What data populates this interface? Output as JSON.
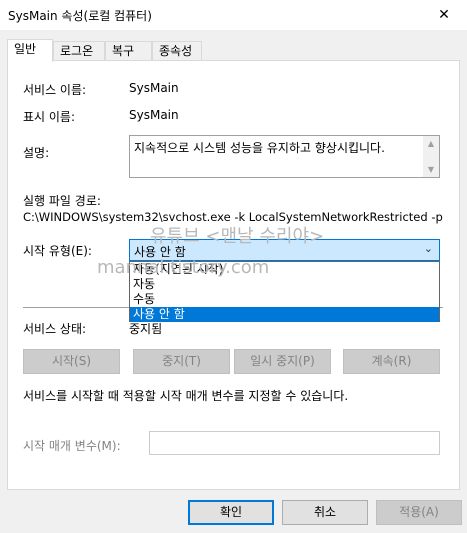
{
  "window": {
    "title": "SysMain 속성(로컬 컴퓨터)",
    "close_glyph": "✕"
  },
  "tabs": [
    {
      "label": "일반"
    },
    {
      "label": "로그온"
    },
    {
      "label": "복구"
    },
    {
      "label": "종속성"
    }
  ],
  "general": {
    "service_name_label": "서비스 이름:",
    "service_name_value": "SysMain",
    "display_name_label": "표시 이름:",
    "display_name_value": "SysMain",
    "description_label": "설명:",
    "description_value": "지속적으로 시스템 성능을 유지하고 향상시킵니다.",
    "path_label": "실행 파일 경로:",
    "path_value": "C:\\WINDOWS\\system32\\svchost.exe -k LocalSystemNetworkRestricted -p",
    "startup_type_label": "시작 유형(E):",
    "startup_type_value": "사용 안 함",
    "startup_options": [
      "자동(지연된 시작)",
      "자동",
      "수동",
      "사용 안 함"
    ],
    "service_status_label": "서비스 상태:",
    "service_status_value": "중지됨",
    "buttons": {
      "start": "시작(S)",
      "stop": "중지(T)",
      "pause": "일시 중지(P)",
      "resume": "계속(R)"
    },
    "start_params_note": "서비스를 시작할 때 적용할 시작 매개 변수를 지정할 수 있습니다.",
    "start_params_label": "시작 매개 변수(M):",
    "start_params_value": ""
  },
  "watermark": {
    "line1": "유튜브 <맨날 수리야>",
    "line2": "mannal.tistory.com"
  },
  "dialog_buttons": {
    "ok": "확인",
    "cancel": "취소",
    "apply": "적용(A)"
  },
  "colors": {
    "accent": "#0078d7",
    "selection": "#cce8ff"
  }
}
